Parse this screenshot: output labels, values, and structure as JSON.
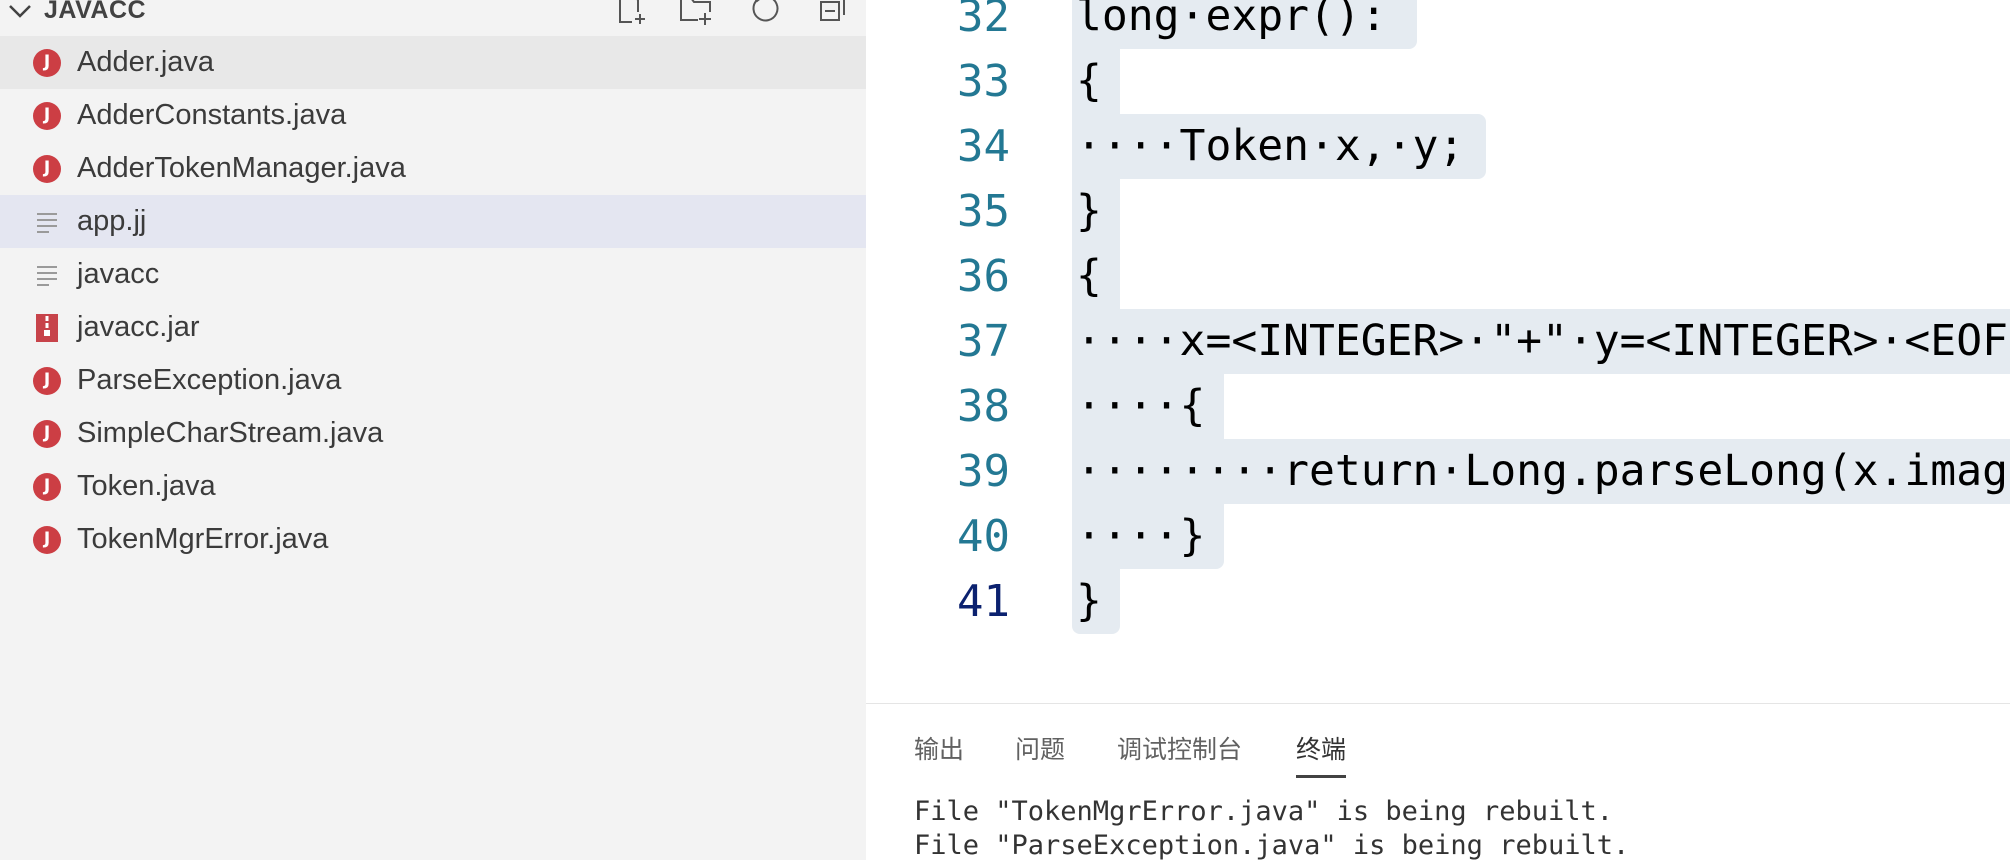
{
  "explorer": {
    "section_title": "JAVACC",
    "actions": [
      "new-file-icon",
      "new-folder-icon",
      "refresh-icon",
      "collapse-all-icon"
    ],
    "files": [
      {
        "name": "Adder.java",
        "icon": "java-icon",
        "state": "hovered"
      },
      {
        "name": "AdderConstants.java",
        "icon": "java-icon"
      },
      {
        "name": "AdderTokenManager.java",
        "icon": "java-icon"
      },
      {
        "name": "app.jj",
        "icon": "text-file-icon",
        "state": "selected"
      },
      {
        "name": "javacc",
        "icon": "text-file-icon"
      },
      {
        "name": "javacc.jar",
        "icon": "archive-icon"
      },
      {
        "name": "ParseException.java",
        "icon": "java-icon"
      },
      {
        "name": "SimpleCharStream.java",
        "icon": "java-icon"
      },
      {
        "name": "Token.java",
        "icon": "java-icon"
      },
      {
        "name": "TokenMgrError.java",
        "icon": "java-icon"
      }
    ]
  },
  "editor": {
    "lines": [
      {
        "number": "32",
        "text": "long·expr():"
      },
      {
        "number": "33",
        "text": "{"
      },
      {
        "number": "34",
        "text": "····Token·x,·y;"
      },
      {
        "number": "35",
        "text": "}"
      },
      {
        "number": "36",
        "text": "{"
      },
      {
        "number": "37",
        "text": "····x=<INTEGER>·\"+\"·y=<INTEGER>·<EOF"
      },
      {
        "number": "38",
        "text": "····{"
      },
      {
        "number": "39",
        "text": "········return·Long.parseLong(x.imag"
      },
      {
        "number": "40",
        "text": "····}"
      },
      {
        "number": "41",
        "text": "}"
      }
    ],
    "current_line": "41"
  },
  "panel": {
    "tabs": [
      {
        "label": "输出"
      },
      {
        "label": "问题"
      },
      {
        "label": "调试控制台"
      },
      {
        "label": "终端",
        "active": true
      }
    ],
    "terminal_lines": [
      "File \"TokenMgrError.java\" is being rebuilt.",
      "File \"ParseException.java\" is being rebuilt."
    ]
  },
  "colors": {
    "sidebar_bg": "#f3f3f3",
    "selection_bg": "#e5ebf1",
    "line_number": "#237893",
    "java_icon": "#cc3e44"
  }
}
